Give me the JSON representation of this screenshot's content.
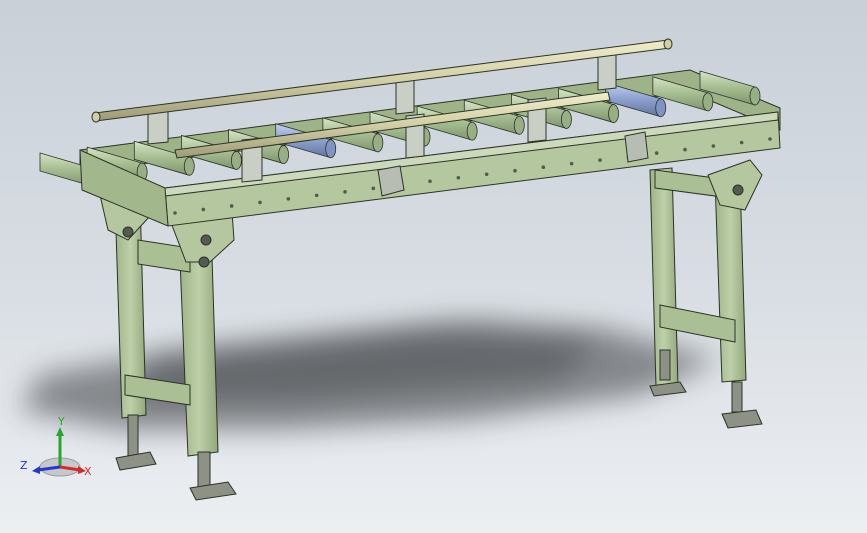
{
  "view": {
    "background_top": "#c9d0d8",
    "background_bottom": "#eceff2"
  },
  "model": {
    "frame_color": "#b5c79e",
    "frame_edge": "#2c3326",
    "roller_color": "#a9c094",
    "roller_highlight": "#d6e3c6",
    "blue_roller_color": "#8fa4d1",
    "guide_rail_color": "#d2cfa6",
    "bracket_color": "#c9cfc4",
    "foot_color": "#8d9186",
    "shadow_color": "#3b3d40"
  },
  "triad": {
    "x_label": "X",
    "y_label": "Y",
    "z_label": "Z",
    "x_color": "#d22b2b",
    "y_color": "#2aa52a",
    "z_color": "#2a36c9"
  }
}
